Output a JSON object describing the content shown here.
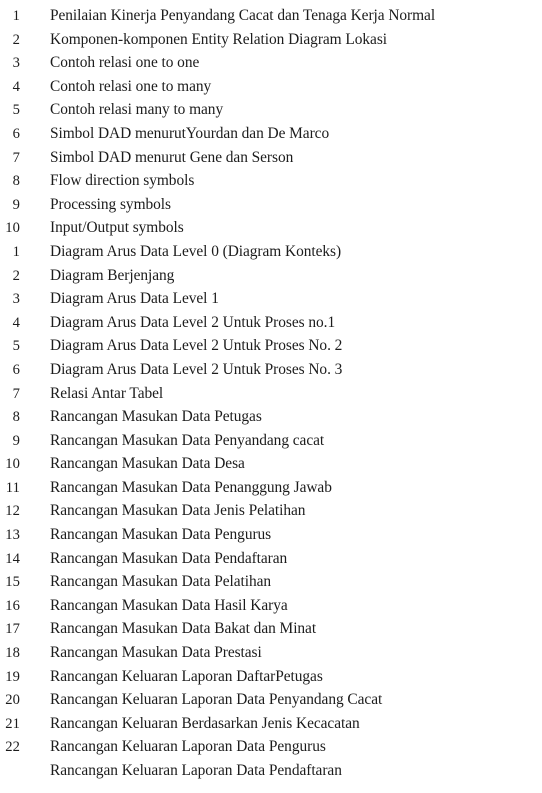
{
  "document": {
    "kind": "list-of-figures",
    "background_color": "#ffffff",
    "text_color": "#1c1c1c"
  },
  "figures": [
    {
      "number": "1",
      "label": "Penilaian Kinerja Penyandang Cacat dan Tenaga Kerja Normal"
    },
    {
      "number": "2",
      "label": "Komponen-komponen Entity Relation Diagram Lokasi"
    },
    {
      "number": "3",
      "label": "Contoh relasi one to one"
    },
    {
      "number": "4",
      "label": "Contoh relasi one to many"
    },
    {
      "number": "5",
      "label": "Contoh relasi many to many"
    },
    {
      "number": "6",
      "label": "Simbol DAD menurutYourdan dan De Marco"
    },
    {
      "number": "7",
      "label": "Simbol DAD menurut Gene dan Serson"
    },
    {
      "number": "8",
      "label": "Flow direction symbols"
    },
    {
      "number": "9",
      "label": "Processing symbols"
    },
    {
      "number": "10",
      "label": "Input/Output symbols"
    },
    {
      "number": "1",
      "label": "Diagram Arus Data Level 0 (Diagram Konteks)"
    },
    {
      "number": "2",
      "label": "Diagram Berjenjang"
    },
    {
      "number": "3",
      "label": "Diagram Arus Data Level 1"
    },
    {
      "number": "4",
      "label": "Diagram Arus Data Level 2 Untuk Proses no.1"
    },
    {
      "number": "5",
      "label": "Diagram Arus Data Level 2 Untuk Proses No. 2"
    },
    {
      "number": "6",
      "label": "Diagram Arus Data Level 2 Untuk Proses No. 3"
    },
    {
      "number": "7",
      "label": "Relasi Antar Tabel"
    },
    {
      "number": "8",
      "label": "Rancangan Masukan Data Petugas"
    },
    {
      "number": "9",
      "label": "Rancangan Masukan Data Penyandang cacat"
    },
    {
      "number": "10",
      "label": "Rancangan Masukan Data Desa"
    },
    {
      "number": "11",
      "label": "Rancangan Masukan Data Penanggung Jawab"
    },
    {
      "number": "12",
      "label": "Rancangan Masukan Data Jenis Pelatihan"
    },
    {
      "number": "13",
      "label": "Rancangan Masukan Data Pengurus"
    },
    {
      "number": "14",
      "label": "Rancangan Masukan Data Pendaftaran"
    },
    {
      "number": "15",
      "label": "Rancangan Masukan Data Pelatihan"
    },
    {
      "number": "16",
      "label": "Rancangan Masukan Data Hasil Karya"
    },
    {
      "number": "17",
      "label": "Rancangan Masukan Data Bakat dan Minat"
    },
    {
      "number": "18",
      "label": "Rancangan Masukan Data Prestasi"
    },
    {
      "number": "19",
      "label": "Rancangan Keluaran Laporan DaftarPetugas"
    },
    {
      "number": "20",
      "label": "Rancangan Keluaran Laporan Data Penyandang Cacat"
    },
    {
      "number": "21",
      "label": "Rancangan Keluaran Berdasarkan Jenis Kecacatan"
    },
    {
      "number": "22",
      "label": "Rancangan Keluaran Laporan Data Pengurus"
    },
    {
      "number": "",
      "label": "Rancangan Keluaran Laporan Data Pendaftaran"
    }
  ]
}
